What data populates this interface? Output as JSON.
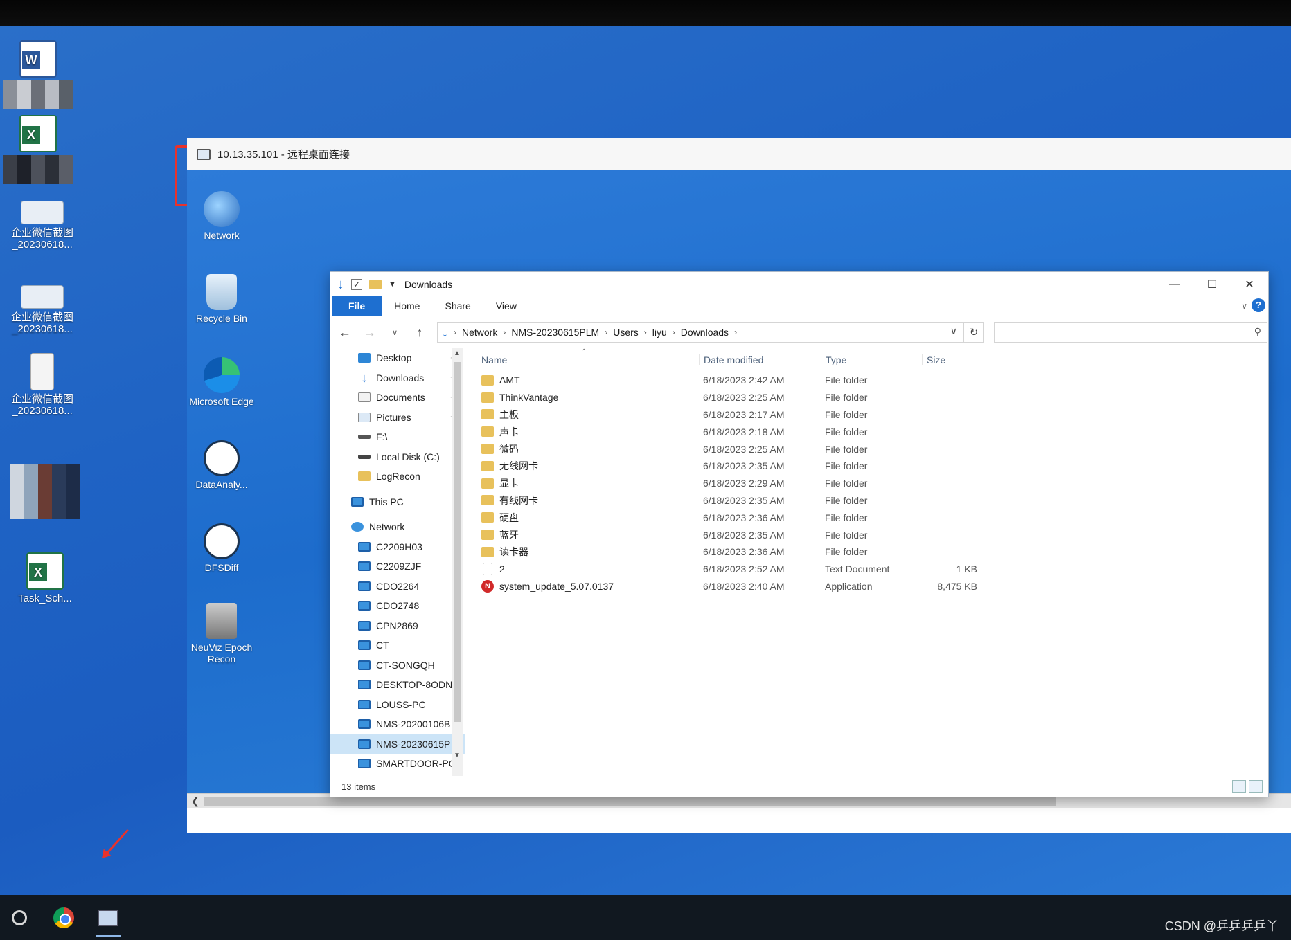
{
  "local_desktop": {
    "icons": [
      {
        "label": "企业微信截图\n_20230618...",
        "icon": "screenshot-icon"
      },
      {
        "label": "企业微信截图\n_20230618...",
        "icon": "screenshot-icon"
      },
      {
        "label": "企业微信截图\n_20230618...",
        "icon": "document-icon"
      },
      {
        "label": "Task_Sch...",
        "icon": "excel-icon"
      }
    ]
  },
  "rdp_window": {
    "title": "10.13.35.101 - 远程桌面连接"
  },
  "remote_desktop": {
    "icons": [
      {
        "label": "Network",
        "icon": "network-icon"
      },
      {
        "label": "Recycle Bin",
        "icon": "recycle-bin-icon"
      },
      {
        "label": "Microsoft Edge",
        "icon": "edge-icon"
      },
      {
        "label": "DataAnaly...",
        "icon": "data-analyzer-icon"
      },
      {
        "label": "DFSDiff",
        "icon": "dfsdiff-icon"
      },
      {
        "label": "NeuViz Epoch Recon",
        "icon": "neuviz-icon"
      }
    ]
  },
  "explorer": {
    "title": "Downloads",
    "ribbon_tabs": [
      "File",
      "Home",
      "Share",
      "View"
    ],
    "breadcrumb": [
      "Network",
      "NMS-20230615PLM",
      "Users",
      "liyu",
      "Downloads"
    ],
    "nav_items": [
      {
        "label": "Desktop",
        "pinned": true
      },
      {
        "label": "Downloads",
        "pinned": true
      },
      {
        "label": "Documents",
        "pinned": true
      },
      {
        "label": "Pictures",
        "pinned": true
      },
      {
        "label": "F:\\"
      },
      {
        "label": "Local Disk (C:)"
      },
      {
        "label": "LogRecon"
      },
      {
        "label": "This PC"
      },
      {
        "label": "Network"
      },
      {
        "label": "C2209H03"
      },
      {
        "label": "C2209ZJF"
      },
      {
        "label": "CDO2264"
      },
      {
        "label": "CDO2748"
      },
      {
        "label": "CPN2869"
      },
      {
        "label": "CT"
      },
      {
        "label": "CT-SONGQH"
      },
      {
        "label": "DESKTOP-8ODN"
      },
      {
        "label": "LOUSS-PC"
      },
      {
        "label": "NMS-20200106B"
      },
      {
        "label": "NMS-20230615P"
      },
      {
        "label": "SMARTDOOR-PC"
      }
    ],
    "columns": [
      "Name",
      "Date modified",
      "Type",
      "Size"
    ],
    "files": [
      {
        "name": "AMT",
        "date": "6/18/2023 2:42 AM",
        "type": "File folder",
        "size": "",
        "kind": "folder"
      },
      {
        "name": "ThinkVantage",
        "date": "6/18/2023 2:25 AM",
        "type": "File folder",
        "size": "",
        "kind": "folder"
      },
      {
        "name": "主板",
        "date": "6/18/2023 2:17 AM",
        "type": "File folder",
        "size": "",
        "kind": "folder"
      },
      {
        "name": "声卡",
        "date": "6/18/2023 2:18 AM",
        "type": "File folder",
        "size": "",
        "kind": "folder"
      },
      {
        "name": "微码",
        "date": "6/18/2023 2:25 AM",
        "type": "File folder",
        "size": "",
        "kind": "folder"
      },
      {
        "name": "无线网卡",
        "date": "6/18/2023 2:35 AM",
        "type": "File folder",
        "size": "",
        "kind": "folder"
      },
      {
        "name": "显卡",
        "date": "6/18/2023 2:29 AM",
        "type": "File folder",
        "size": "",
        "kind": "folder"
      },
      {
        "name": "有线网卡",
        "date": "6/18/2023 2:35 AM",
        "type": "File folder",
        "size": "",
        "kind": "folder"
      },
      {
        "name": "硬盘",
        "date": "6/18/2023 2:36 AM",
        "type": "File folder",
        "size": "",
        "kind": "folder"
      },
      {
        "name": "蓝牙",
        "date": "6/18/2023 2:35 AM",
        "type": "File folder",
        "size": "",
        "kind": "folder"
      },
      {
        "name": "读卡器",
        "date": "6/18/2023 2:36 AM",
        "type": "File folder",
        "size": "",
        "kind": "folder"
      },
      {
        "name": "2",
        "date": "6/18/2023 2:52 AM",
        "type": "Text Document",
        "size": "1 KB",
        "kind": "text"
      },
      {
        "name": "system_update_5.07.0137",
        "date": "6/18/2023 2:40 AM",
        "type": "Application",
        "size": "8,475 KB",
        "kind": "app"
      }
    ],
    "status": "13 items"
  },
  "watermark": "CSDN @乒乒乒乒丫",
  "colors": {
    "accent": "#1e6fd0",
    "highlight": "#e8322c",
    "folder": "#e8c15b"
  }
}
